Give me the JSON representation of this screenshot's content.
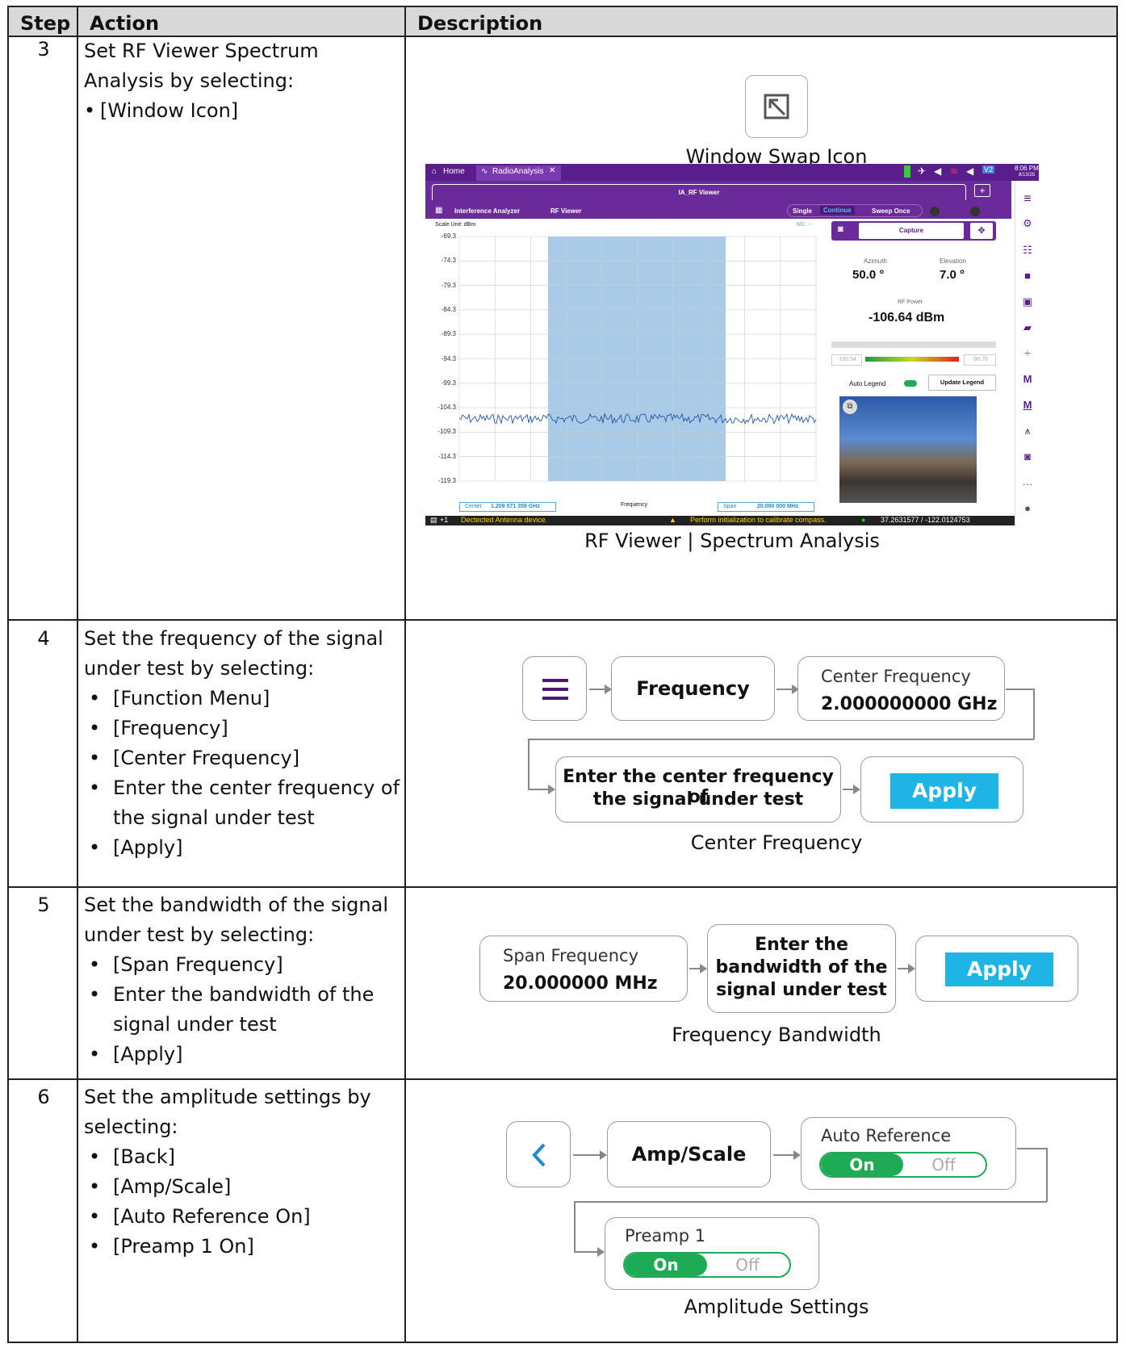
{
  "header": {
    "step": "Step",
    "action": "Action",
    "description": "Description"
  },
  "rows": [
    {
      "step": "3",
      "action_lines": [
        "Set RF Viewer Spectrum",
        "Analysis by selecting:"
      ],
      "bullets": [
        "[Window Icon]"
      ],
      "icon_caption": "Window Swap Icon",
      "caption": "RF Viewer | Spectrum Analysis"
    },
    {
      "step": "4",
      "action_lines": [
        "Set the frequency of the signal",
        "under test by selecting:"
      ],
      "bullets": [
        "[Function Menu]",
        "[Frequency]",
        "[Center Frequency]",
        "Enter the center frequency of",
        "the signal under test",
        "[Apply]"
      ],
      "flow": {
        "frequency": "Frequency",
        "center_label": "Center Frequency",
        "center_value": "2.000000000 GHz",
        "enter_line1": "Enter the center frequency of",
        "enter_line2": "the signal under test",
        "apply": "Apply"
      },
      "caption": "Center Frequency"
    },
    {
      "step": "5",
      "action_lines": [
        "Set the bandwidth of the signal",
        "under test by selecting:"
      ],
      "bullets": [
        "[Span Frequency]",
        "Enter the bandwidth of the",
        "signal under test",
        "[Apply]"
      ],
      "flow": {
        "span_label": "Span Frequency",
        "span_value": "20.000000 MHz",
        "enter_line1": "Enter the",
        "enter_line2": "bandwidth of the",
        "enter_line3": "signal under test",
        "apply": "Apply"
      },
      "caption": "Frequency Bandwidth"
    },
    {
      "step": "6",
      "action_lines": [
        "Set the amplitude settings by",
        "selecting:"
      ],
      "bullets": [
        "[Back]",
        "[Amp/Scale]",
        "[Auto Reference On]",
        "[Preamp 1 On]"
      ],
      "flow": {
        "amp": "Amp/Scale",
        "auto_ref_label": "Auto Reference",
        "preamp_label": "Preamp 1",
        "on": "On",
        "off": "Off"
      },
      "caption": "Amplitude Settings"
    }
  ],
  "screenshot": {
    "tab_home": "Home",
    "tab_app": "RadioAnalysis",
    "time": "8:06 PM",
    "date": "8/13/25",
    "window_title": "IA_RF Viewer",
    "menu_app": "Interference Analyzer",
    "menu_mode": "RF Viewer",
    "sweep_single": "Single",
    "sweep_continue": "Continue",
    "sweep_once": "Sweep Once",
    "scale_unit": "Scale Unit: dBm",
    "marker": "M1: --",
    "y_ticks": [
      "-69.3",
      "-74.3",
      "-79.3",
      "-84.3",
      "-89.3",
      "-94.3",
      "-99.3",
      "-104.3",
      "-109.3",
      "-114.3",
      "-119.3"
    ],
    "center_label": "Center",
    "center_value": "1.209 571 359 GHz",
    "x_label": "Frequency",
    "span_label": "Span",
    "span_value": "20.000 000 MHz",
    "capture": "Capture",
    "azimuth_label": "Azimuth",
    "azimuth_value": "50.0 °",
    "elevation_label": "Elevation",
    "elevation_value": "7.0 °",
    "rf_power_label": "RF Power",
    "rf_power_value": "-106.64 dBm",
    "legend_min": "-100.54",
    "legend_max": "-96.76",
    "auto_legend": "Auto Legend",
    "update_legend": "Update Legend",
    "status_count": "+1",
    "status_msg": "Dectected Antenna device.",
    "status_warn": "Perform initialization to calibrate compass.",
    "status_gps": "37.2631577 / -122.0124753",
    "version": "V2"
  }
}
